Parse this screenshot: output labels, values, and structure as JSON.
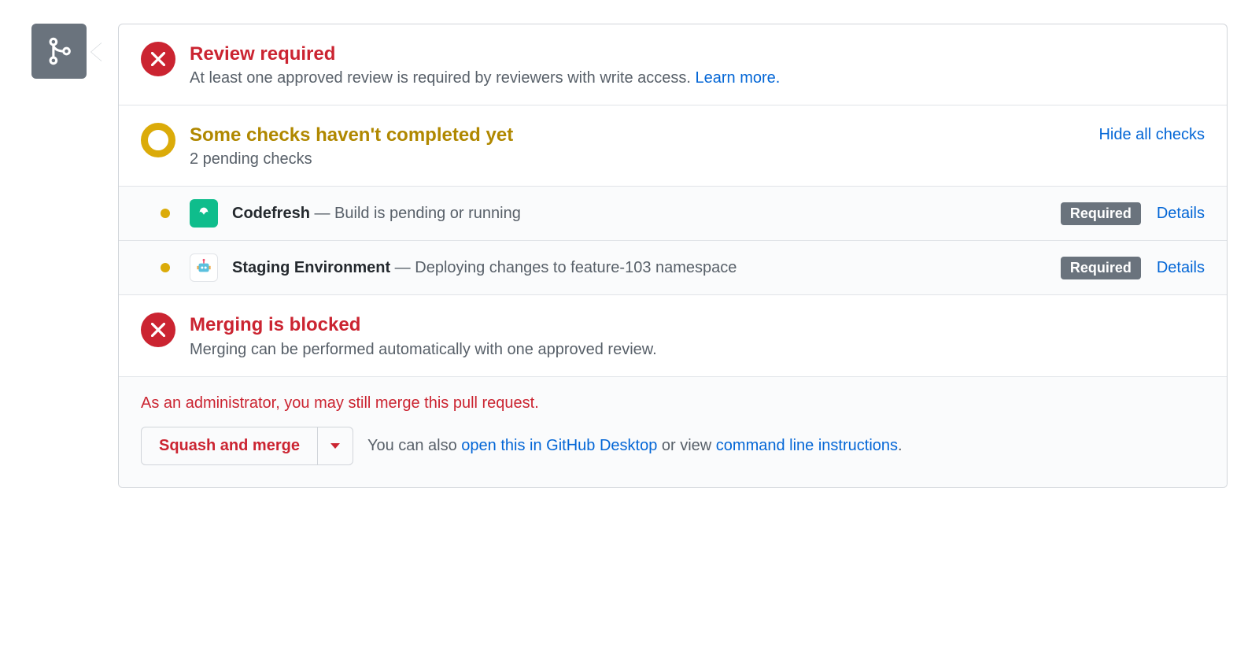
{
  "review": {
    "title": "Review required",
    "subtitle": "At least one approved review is required by reviewers with write access. ",
    "learn_more": "Learn more."
  },
  "checks_summary": {
    "title": "Some checks haven't completed yet",
    "subtitle": "2 pending checks",
    "toggle": "Hide all checks"
  },
  "checks": [
    {
      "name": "Codefresh",
      "desc": "Build is pending or running",
      "required": "Required",
      "details": "Details"
    },
    {
      "name": "Staging Environment",
      "desc": "Deploying changes to feature-103 namespace",
      "required": "Required",
      "details": "Details"
    }
  ],
  "blocked": {
    "title": "Merging is blocked",
    "subtitle": "Merging can be performed automatically with one approved review."
  },
  "footer": {
    "admin_note": "As an administrator, you may still merge this pull request.",
    "merge_button": "Squash and merge",
    "prefix": "You can also ",
    "open_desktop": "open this in GitHub Desktop",
    "middle": " or view ",
    "cli": "command line instructions",
    "suffix": "."
  }
}
